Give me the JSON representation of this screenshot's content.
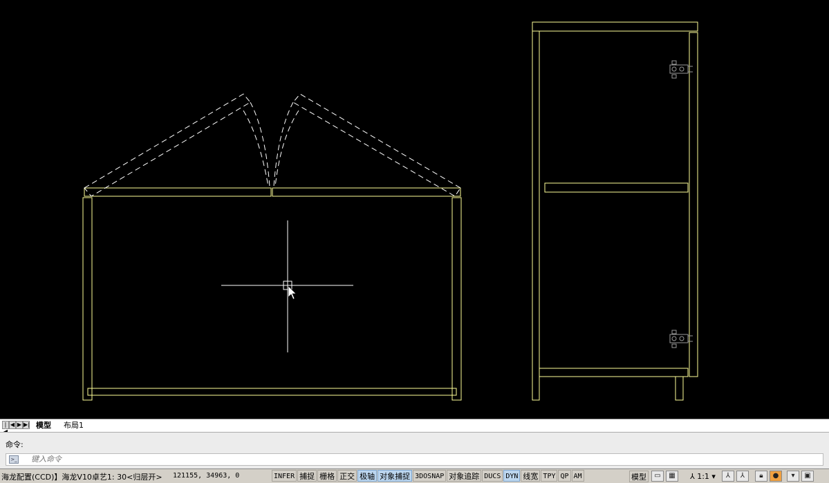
{
  "layout_tabs": [
    {
      "label": "模型",
      "active": true
    },
    {
      "label": "布局1",
      "active": false
    }
  ],
  "nav_buttons": [
    "|◀",
    "◀",
    "▶",
    "▶|"
  ],
  "command": {
    "history": "命令:",
    "placeholder": "键入命令"
  },
  "status": {
    "profile_text": "海龙配置(CCD)】海龙V10卓艺1: 30<归层开>",
    "coordinates": "121155, 34963, 0",
    "toggles": [
      {
        "label": "INFER",
        "on": false
      },
      {
        "label": "捕捉",
        "on": false
      },
      {
        "label": "栅格",
        "on": false
      },
      {
        "label": "正交",
        "on": false
      },
      {
        "label": "极轴",
        "on": true
      },
      {
        "label": "对象捕捉",
        "on": true
      },
      {
        "label": "3DOSNAP",
        "on": false
      },
      {
        "label": "对象追踪",
        "on": false
      },
      {
        "label": "DUCS",
        "on": false
      },
      {
        "label": "DYN",
        "on": true
      },
      {
        "label": "线宽",
        "on": false
      },
      {
        "label": "TPY",
        "on": false
      },
      {
        "label": "QP",
        "on": false
      },
      {
        "label": "AM",
        "on": false
      }
    ],
    "model_label": "模型",
    "scale": "1:1",
    "right_icons": [
      "layout-quick-icon",
      "drawing-quick-icon",
      "annotation-scale-icon",
      "annotation-visibility-icon",
      "auto-scale-icon",
      "lock-icon",
      "hardware-accel-icon",
      "status-menu-icon",
      "clean-screen-icon"
    ]
  },
  "colors": {
    "background": "#000000",
    "outline": "#ffff99",
    "hidden": "#ffffff",
    "crosshair": "#ffffff",
    "hinge": "#9a9a9a"
  }
}
